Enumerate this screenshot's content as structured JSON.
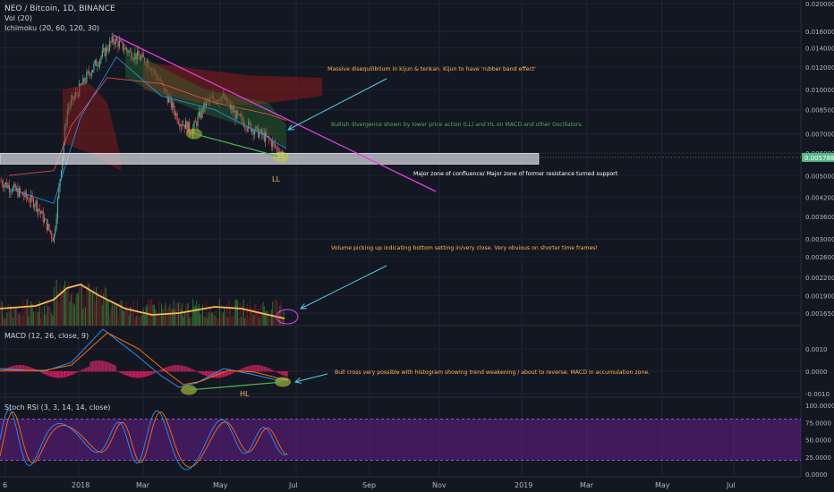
{
  "header": {
    "symbol_line": "NEO / Bitcoin, 1D, BINANCE",
    "vol_label": "Vol (20)",
    "ichimoku_label": "Ichimoku (20, 60, 120, 30)",
    "macd_label": "MACD (12, 26, close, 9)",
    "stoch_label": "Stoch RSI (3, 3, 14, 14, close)"
  },
  "colors": {
    "background": "#131722",
    "grid": "#1f2433",
    "axis_text": "#b2b5be",
    "up_candle": "#53b987",
    "down_candle": "#eb4d5c",
    "trendline": "#e040e0",
    "arrow": "#4dd0e1",
    "annotation_orange": "#ffb74d",
    "annotation_green": "#4caf50",
    "annotation_white": "#ffffff",
    "support_zone": "#d1d4dc",
    "volume_ma": "#ffb74d",
    "macd_line": "#2196f3",
    "signal_line": "#ff6d00",
    "stoch_k": "#2196f3",
    "stoch_d": "#ff6d00",
    "stoch_band": "#7b1fa2"
  },
  "price_axis": {
    "ticks": [
      "0.020000",
      "0.016000",
      "0.014000",
      "0.012000",
      "0.010000",
      "0.008500",
      "0.007000",
      "0.006000",
      "0.005000",
      "0.004200",
      "0.003600",
      "0.003000",
      "0.002600",
      "0.002200",
      "0.001900",
      "0.001650"
    ],
    "current_price": "0.005788"
  },
  "macd_axis": {
    "ticks": [
      "0.0010",
      "0.0000",
      "-0.0010"
    ]
  },
  "stoch_axis": {
    "ticks": [
      "100.0000",
      "75.0000",
      "50.0000",
      "25.0000",
      "0.0000"
    ]
  },
  "time_axis": {
    "labels": [
      "6",
      "2018",
      "Mar",
      "May",
      "Jul",
      "Sep",
      "Nov",
      "2019",
      "Mar",
      "May",
      "Jul"
    ]
  },
  "annotations": {
    "kijun": "Massive disequilibrium in kijun & tenkan. Kijun to have 'rubber band effect'",
    "divergence": "Bullish divergence shown by lower price action (LL) and HL on MACD and other Oscillators.",
    "zone": "Major zone of confluence/ Major zone of former resistance turned support",
    "ll_label": "LL",
    "volume": "Volume picking up indicating bottom setting in/very close. Very obvious on shorter time frames!",
    "bull_cross": "Bull cross very possible with histogram showing trend weakening / about to reverse. MACD in accumulation zone.",
    "hl_label": "HL"
  },
  "chart_data": {
    "type": "candlestick",
    "title": "NEO / Bitcoin, 1D, BINANCE",
    "approx_close_path": [
      {
        "x": "Dec",
        "y": 0.0048
      },
      {
        "x": "Jan",
        "y": 0.009
      },
      {
        "x": "2018-01-15",
        "y": 0.015
      },
      {
        "x": "Feb",
        "y": 0.013
      },
      {
        "x": "Mar",
        "y": 0.0115
      },
      {
        "x": "Apr",
        "y": 0.0075
      },
      {
        "x": "May",
        "y": 0.0095
      },
      {
        "x": "Jun",
        "y": 0.007
      },
      {
        "x": "2018-06-25",
        "y": 0.005788
      }
    ],
    "y_scale": "log",
    "macd": {
      "approx_range": [
        -0.001,
        0.0012
      ]
    },
    "stoch_rsi": {
      "bands": [
        20,
        80
      ],
      "range": [
        0,
        100
      ]
    }
  }
}
